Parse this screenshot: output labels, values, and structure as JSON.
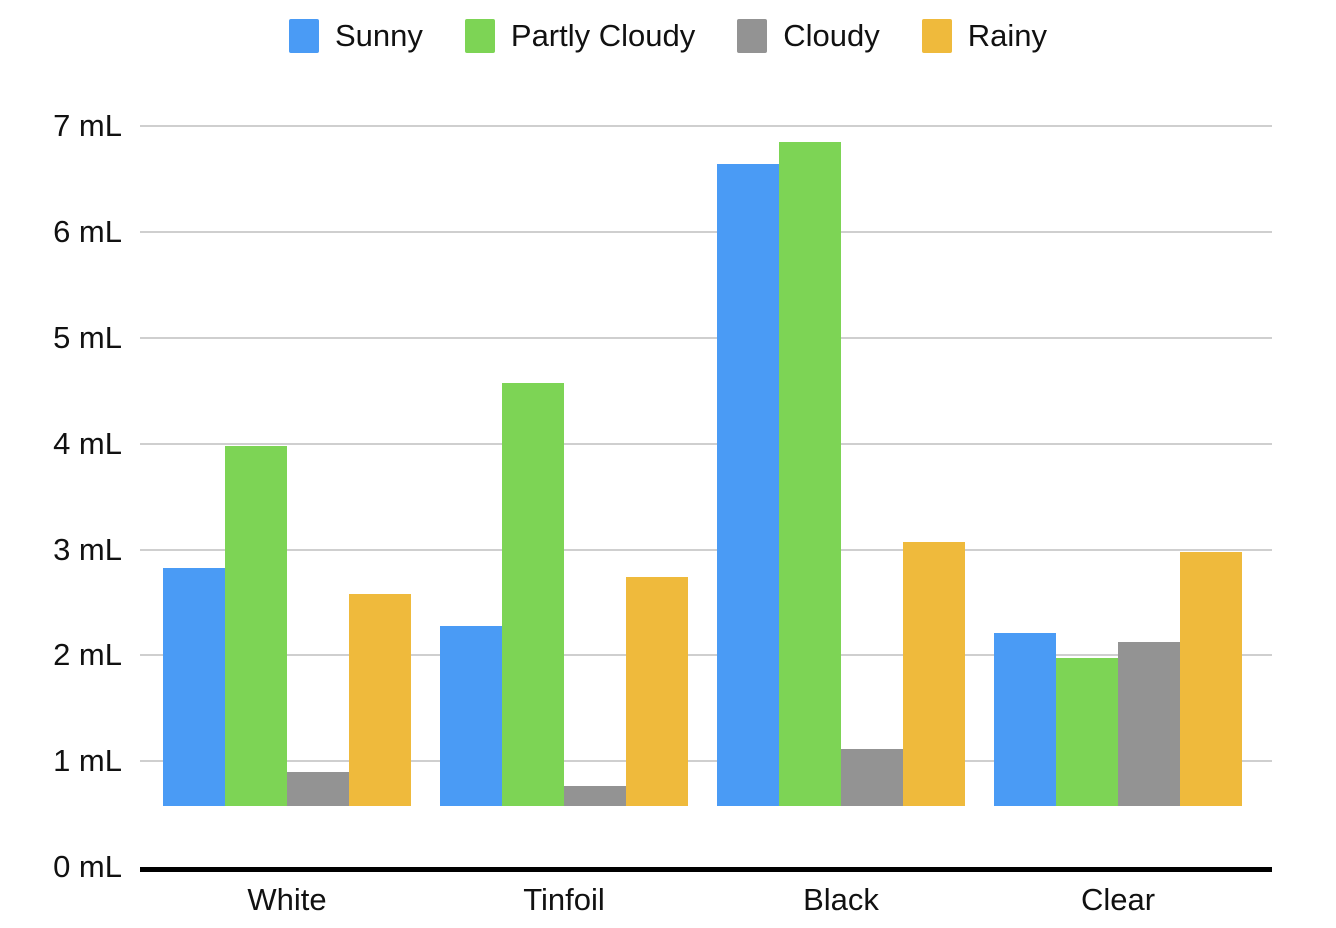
{
  "chart_data": {
    "type": "bar",
    "title": "",
    "subtitle": "",
    "xlabel": "",
    "ylabel": "",
    "categories": [
      "White",
      "Tinfoil",
      "Black",
      "Clear"
    ],
    "series": [
      {
        "name": "Sunny",
        "color": "#4a9bf5",
        "values": [
          2.25,
          1.7,
          6.07,
          1.64
        ]
      },
      {
        "name": "Partly Cloudy",
        "color": "#7dd455",
        "values": [
          3.4,
          4.0,
          6.28,
          1.4
        ]
      },
      {
        "name": "Cloudy",
        "color": "#939393",
        "values": [
          0.32,
          0.19,
          0.54,
          1.55
        ]
      },
      {
        "name": "Rainy",
        "color": "#efba3c",
        "values": [
          2.0,
          2.16,
          2.5,
          2.4
        ]
      }
    ],
    "ylim": [
      0,
      7
    ],
    "ytick_values": [
      0,
      1,
      2,
      3,
      4,
      5,
      6,
      7
    ],
    "ytick_labels": [
      "0 mL",
      "1 mL",
      "2 mL",
      "3 mL",
      "4 mL",
      "5 mL",
      "6 mL",
      "7 mL"
    ],
    "y_unit": "mL",
    "grid": true,
    "grid_axis": "y",
    "grid_color": "#cfcfcf",
    "axis_line_color": "#000000",
    "background_color": "#ffffff",
    "legend": {
      "position": "top",
      "entries": [
        {
          "label": "Sunny",
          "color": "#4a9bf5"
        },
        {
          "label": "Partly Cloudy",
          "color": "#7dd455"
        },
        {
          "label": "Cloudy",
          "color": "#939393"
        },
        {
          "label": "Rainy",
          "color": "#efba3c"
        }
      ]
    },
    "annotations": []
  }
}
